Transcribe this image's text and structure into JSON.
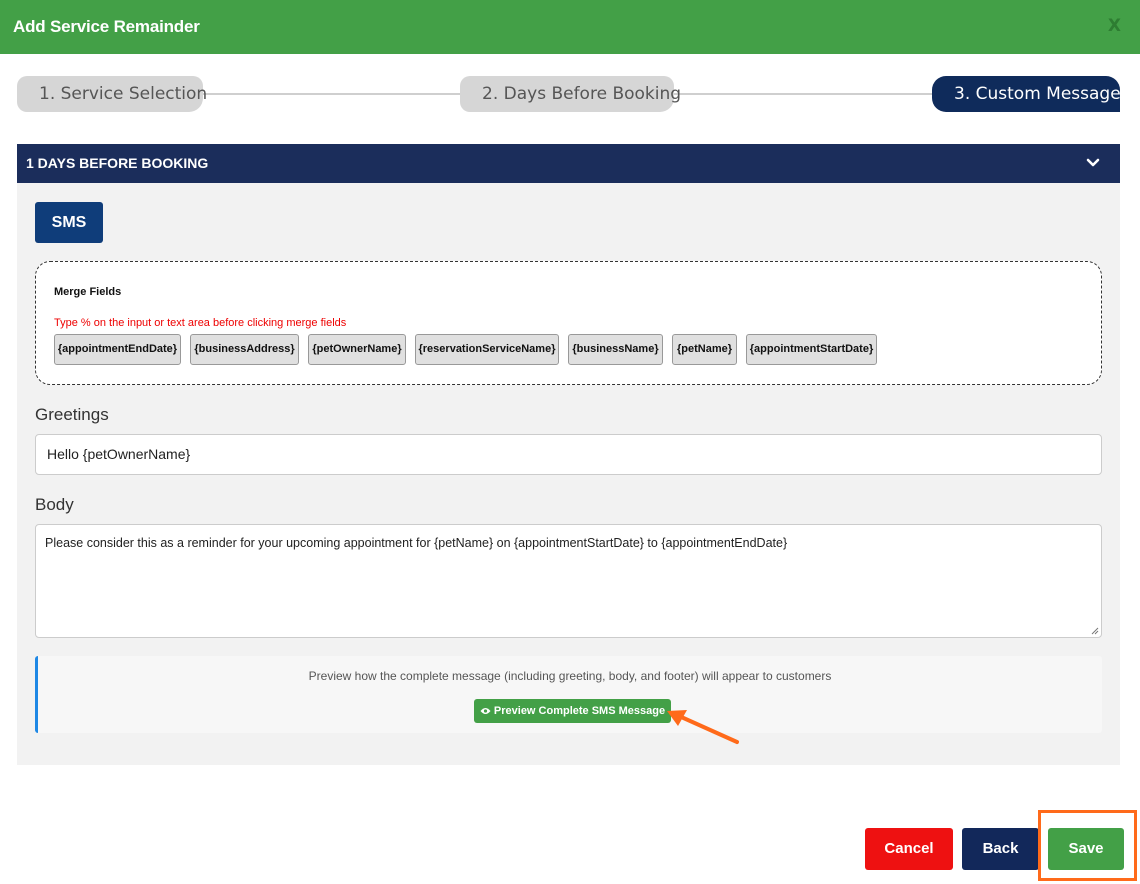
{
  "header": {
    "title": "Add Service Remainder",
    "close_label": "X"
  },
  "stepper": {
    "steps": [
      {
        "label": "1. Service Selection",
        "state": "inactive"
      },
      {
        "label": "2. Days Before Booking",
        "state": "inactive"
      },
      {
        "label": "3. Custom Message",
        "state": "active"
      }
    ]
  },
  "panel": {
    "title": "1 DAYS BEFORE BOOKING",
    "channel_label": "SMS",
    "merge_fields": {
      "title": "Merge Fields",
      "note": "Type % on the input or text area before clicking merge fields",
      "chips": [
        "{appointmentEndDate}",
        "{businessAddress}",
        "{petOwnerName}",
        "{reservationServiceName}",
        "{businessName}",
        "{petName}",
        "{appointmentStartDate}"
      ]
    },
    "greetings": {
      "label": "Greetings",
      "value": "Hello {petOwnerName}"
    },
    "body": {
      "label": "Body",
      "value": "Please consider this as a reminder for your upcoming appointment for {petName} on {appointmentStartDate} to {appointmentEndDate}"
    },
    "preview": {
      "text": "Preview how the complete message (including greeting, body, and footer) will appear to customers",
      "button_label": "Preview Complete SMS Message"
    }
  },
  "footer": {
    "cancel_label": "Cancel",
    "back_label": "Back",
    "save_label": "Save"
  },
  "colors": {
    "header_green": "#43a047",
    "navy": "#1b2d5b",
    "cancel_red": "#ee1111",
    "highlight_orange": "#ff6a1a"
  }
}
